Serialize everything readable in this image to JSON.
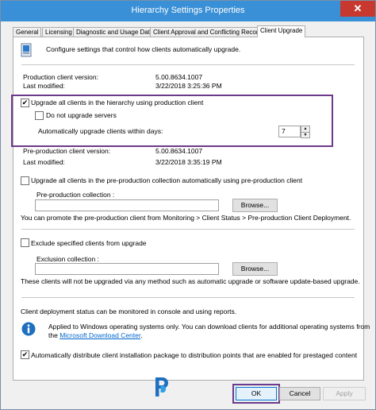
{
  "window": {
    "title": "Hierarchy Settings Properties",
    "close_glyph": "✕"
  },
  "tabs": [
    {
      "label": "General"
    },
    {
      "label": "Licensing"
    },
    {
      "label": "Diagnostic and Usage Data"
    },
    {
      "label": "Client Approval and Conflicting Records"
    },
    {
      "label": "Client Upgrade"
    }
  ],
  "header_text": "Configure settings that control how clients automatically upgrade.",
  "production": {
    "version_label": "Production client version:",
    "version_value": "5.00.8634.1007",
    "modified_label": "Last modified:",
    "modified_value": "3/22/2018 3:25:36 PM"
  },
  "upgrade_all": {
    "label": "Upgrade all clients in the hierarchy using production client",
    "checked": true
  },
  "no_servers": {
    "label": "Do not upgrade servers",
    "checked": false
  },
  "within_days": {
    "label": "Automatically upgrade clients within days:",
    "value": "7"
  },
  "preproduction": {
    "version_label": "Pre-production client version:",
    "version_value": "5.00.8634.1007",
    "modified_label": "Last modified:",
    "modified_value": "3/22/2018 3:35:19 PM"
  },
  "preprod_upgrade": {
    "label": "Upgrade all clients in the pre-production collection automatically using pre-production client",
    "checked": false
  },
  "preprod_collection_label": "Pre-production collection :",
  "browse_label": "Browse...",
  "promote_text": "You can promote the pre-production client from Monitoring > Client Status > Pre-production Client Deployment.",
  "exclude": {
    "label": "Exclude specified clients from upgrade",
    "checked": false
  },
  "exclusion_collection_label": "Exclusion collection :",
  "exclude_note": "These clients will not be upgraded via any method such as automatic upgrade or software update-based upgrade.",
  "monitor_text": "Client deployment status can be monitored in console and using reports.",
  "info_text_1": "Applied to Windows operating systems only. You can download clients for additional operating systems from",
  "info_text_2_prefix": "the ",
  "info_link": "Microsoft Download Center",
  "info_text_2_suffix": ".",
  "distribute": {
    "label": "Automatically distribute client installation package to distribution points that are enabled for prestaged content",
    "checked": true
  },
  "buttons": {
    "ok": "OK",
    "cancel": "Cancel",
    "apply": "Apply"
  },
  "colors": {
    "titlebar": "#3a90d6",
    "highlight": "#6c3a8a",
    "link": "#0066cc",
    "info_icon": "#1e6fc0"
  },
  "icons": [
    "close-icon",
    "client-upgrade-icon",
    "info-icon",
    "logo-icon",
    "spinner-up-icon",
    "spinner-down-icon"
  ]
}
